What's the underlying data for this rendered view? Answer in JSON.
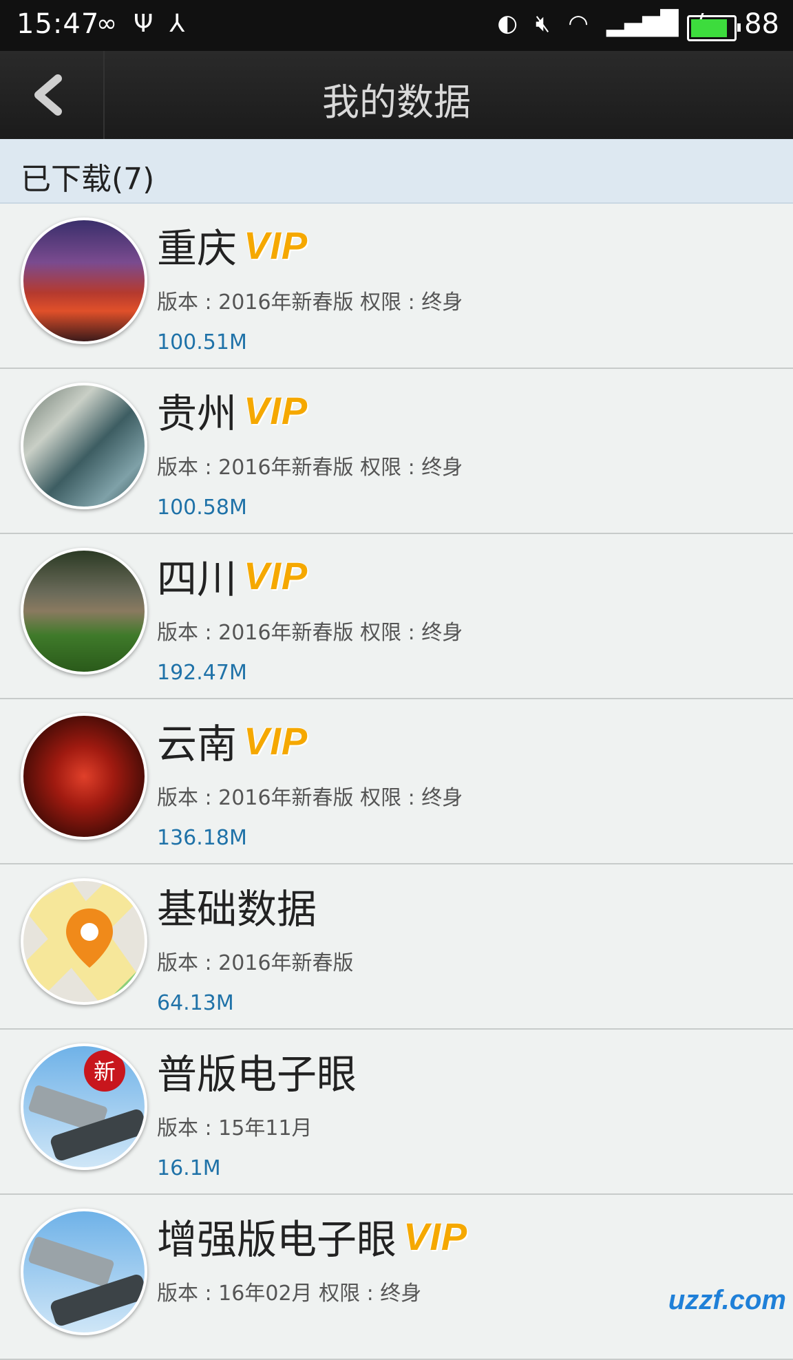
{
  "status_bar": {
    "time": "15:47",
    "left_icons": [
      "infinity-icon",
      "usb-icon",
      "share-icon"
    ],
    "right_icons": [
      "rotate-lock-icon",
      "mute-icon",
      "wifi-icon",
      "signal-icon",
      "charging-icon"
    ],
    "battery_level": 88,
    "battery_text": "88"
  },
  "header": {
    "back_icon": "chevron-left-icon",
    "title": "我的数据"
  },
  "section": {
    "label": "已下载(7)"
  },
  "items": [
    {
      "title": "重庆",
      "vip": "VIP",
      "meta": "版本 : 2016年新春版 权限 : 终身",
      "size": "100.51M",
      "thumb": "city-night"
    },
    {
      "title": "贵州",
      "vip": "VIP",
      "meta": "版本 : 2016年新春版 权限 : 终身",
      "size": "100.58M",
      "thumb": "river-stones"
    },
    {
      "title": "四川",
      "vip": "VIP",
      "meta": "版本 : 2016年新春版 权限 : 终身",
      "size": "192.47M",
      "thumb": "green-hills"
    },
    {
      "title": "云南",
      "vip": "VIP",
      "meta": "版本 : 2016年新春版 权限 : 终身",
      "size": "136.18M",
      "thumb": "red-lanterns"
    },
    {
      "title": "基础数据",
      "vip": "",
      "meta": "版本 : 2016年新春版",
      "size": "64.13M",
      "thumb": "map-pin"
    },
    {
      "title": "普版电子眼",
      "vip": "",
      "meta": "版本 : 15年11月",
      "size": "16.1M",
      "thumb": "camera-new",
      "badge": "新"
    },
    {
      "title": "增强版电子眼",
      "vip": "VIP",
      "meta": "版本 : 16年02月 权限 : 终身",
      "size": "",
      "thumb": "camera"
    }
  ],
  "watermark": "uzzf.com",
  "colors": {
    "titlebar": "#1f1f1f",
    "section_bg": "#dde8f1",
    "vip": "#f5a800",
    "size_text": "#1f72a8",
    "battery": "#3ddc3d"
  }
}
